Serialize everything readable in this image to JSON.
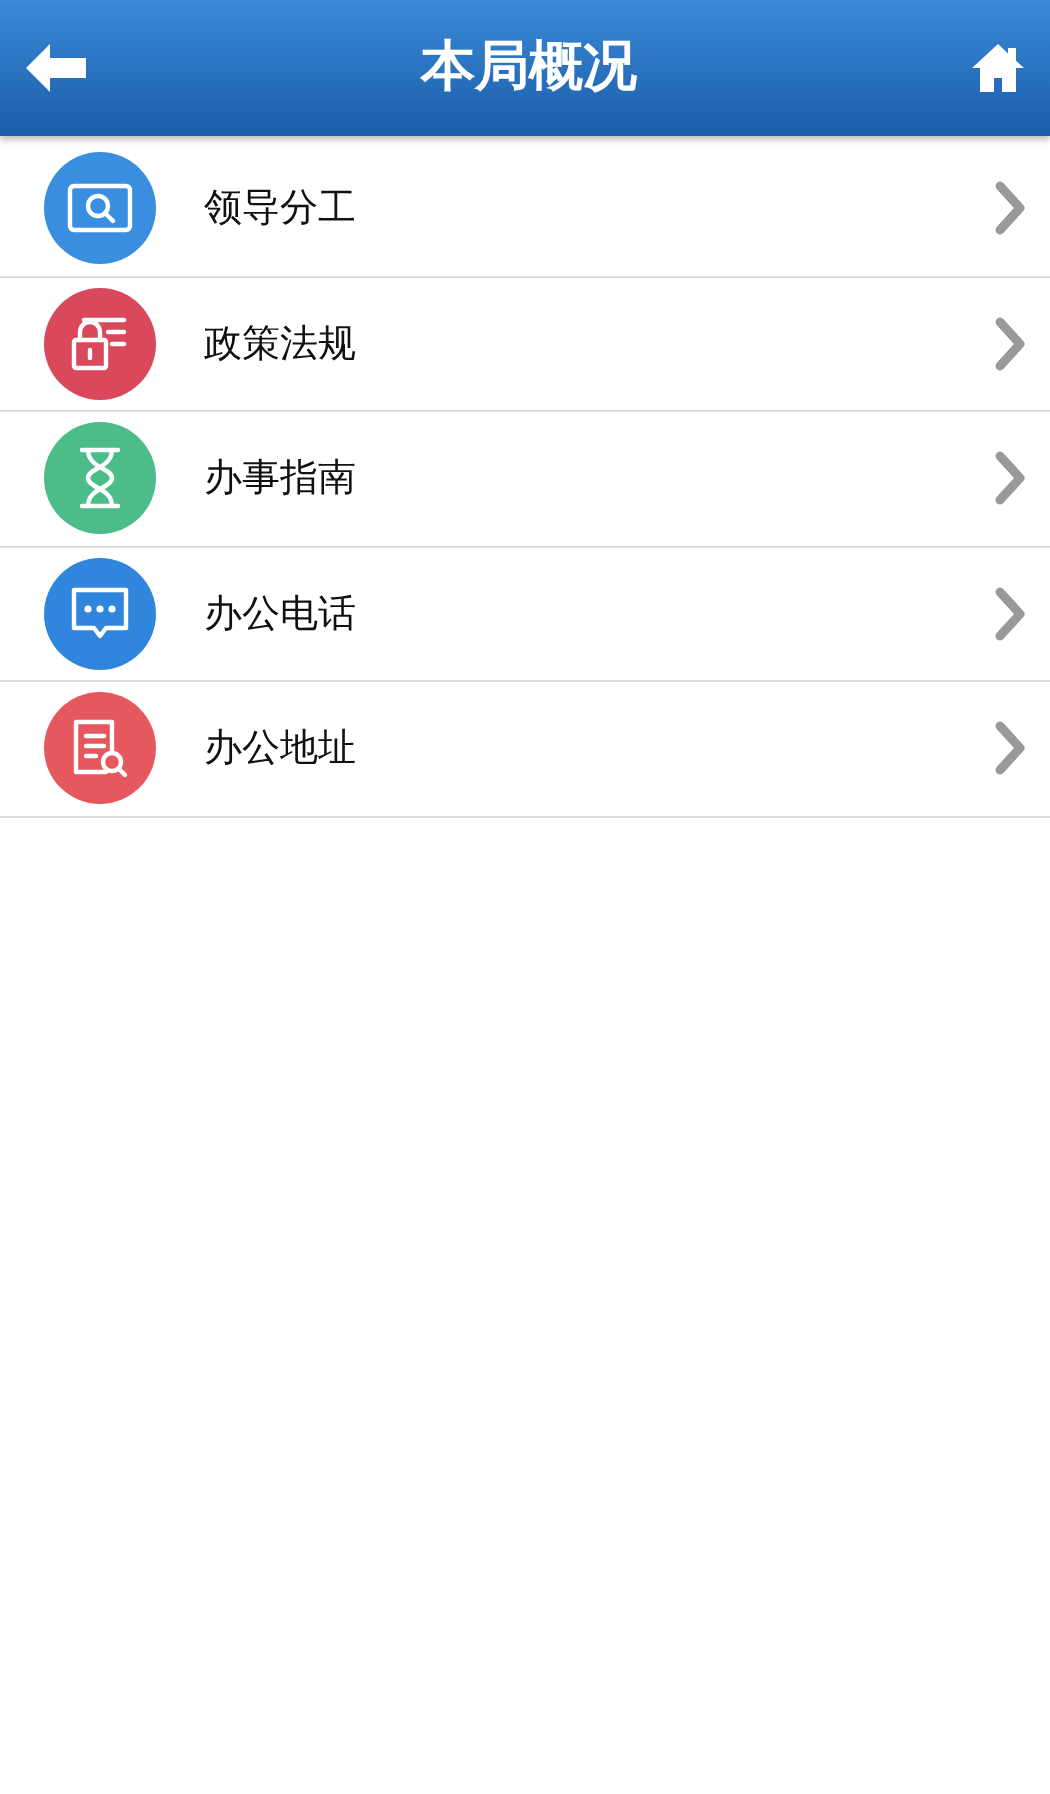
{
  "header": {
    "title": "本局概况"
  },
  "items": [
    {
      "label": "领导分工",
      "kind": "search",
      "color": "#3a8ee0"
    },
    {
      "label": "政策法规",
      "kind": "lock",
      "color": "#d9495b"
    },
    {
      "label": "办事指南",
      "kind": "hourglass",
      "color": "#4cbc89"
    },
    {
      "label": "办公电话",
      "kind": "chat",
      "color": "#2f86dc"
    },
    {
      "label": "办公地址",
      "kind": "document",
      "color": "#e5585e"
    }
  ]
}
